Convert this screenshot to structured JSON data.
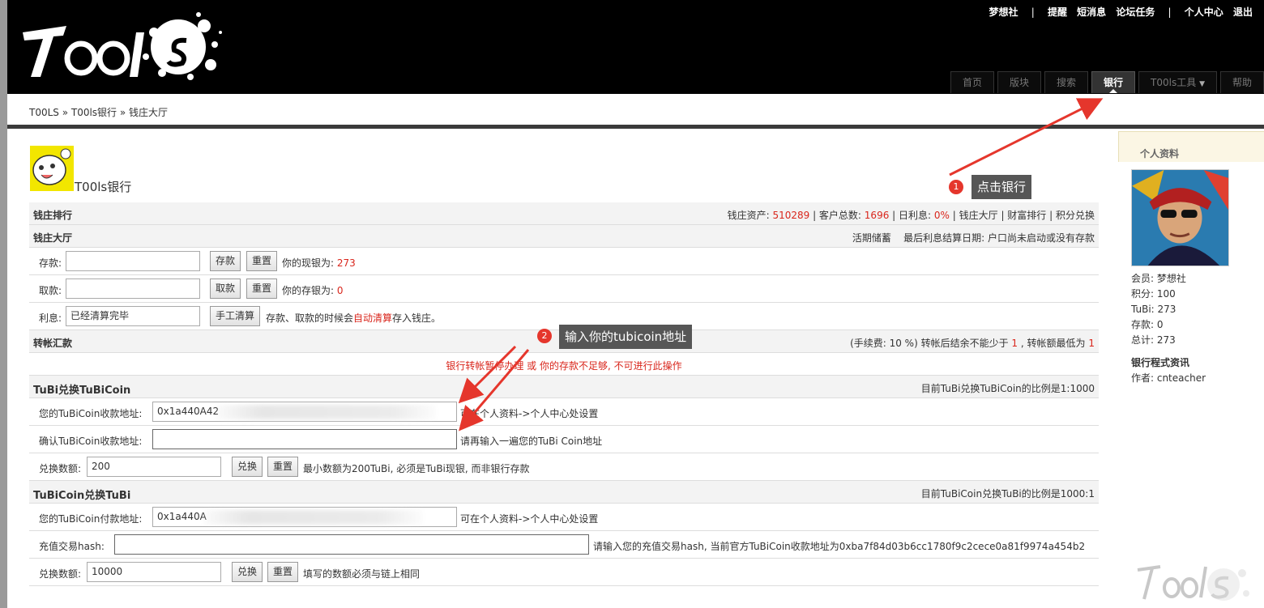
{
  "header": {
    "logo_text": "T00ls",
    "top_links": [
      "梦想社",
      "|",
      "提醒",
      "短消息",
      "论坛任务",
      "|",
      "个人中心",
      "退出"
    ],
    "nav": [
      {
        "label": "首页",
        "active": false
      },
      {
        "label": "版块",
        "active": false
      },
      {
        "label": "搜索",
        "active": false
      },
      {
        "label": "银行",
        "active": true
      },
      {
        "label": "T00ls工具",
        "active": false
      },
      {
        "label": "帮助",
        "active": false
      }
    ]
  },
  "breadcrumb": "T00LS » T00ls银行 » 钱庄大厅",
  "bank_title": "T00ls银行",
  "ranking": {
    "title": "钱庄排行",
    "assets_label": "钱庄资产:",
    "assets": "510289",
    "customers_label": "客户总数:",
    "customers": "1696",
    "interest_label": "日利息:",
    "interest": "0%",
    "links": [
      "钱庄大厅",
      "财富排行",
      "积分兑换"
    ]
  },
  "hall": {
    "title": "钱庄大厅",
    "right1": "活期储蓄",
    "right2": "最后利息结算日期: 户口尚未启动或没有存款",
    "deposit_label": "存款:",
    "deposit_btn": "存款",
    "reset": "重置",
    "cash_text": "你的现银为:",
    "cash": "273",
    "withdraw_label": "取款:",
    "withdraw_btn": "取款",
    "saving_text": "你的存银为:",
    "saving": "0",
    "interest_label": "利息:",
    "interest_value": "已经清算完毕",
    "manual_btn": "手工清算",
    "interest_note_a": "存款、取款的时候会",
    "interest_note_b": "自动清算",
    "interest_note_c": "存入钱庄。"
  },
  "transfer": {
    "title": "转帐汇款",
    "fee_a": "(手续费: 10 %) 转帐后结余不能少于",
    "fee_min": "1",
    "fee_b": ", 转帐额最低为",
    "fee_low": "1",
    "notice": "银行转帐暂停办理 或 你的存款不足够, 不可进行此操作"
  },
  "tubi_to_coin": {
    "title": "TuBi兑换TuBiCoin",
    "ratio": "目前TuBi兑换TuBiCoin的比例是1:1000",
    "addr_label": "您的TuBiCoin收款地址:",
    "addr_value": "0x1a440A42",
    "addr_note": "可在个人资料->个人中心处设置",
    "confirm_label": "确认TuBiCoin收款地址:",
    "confirm_note": "请再输入一遍您的TuBi Coin地址",
    "amount_label": "兑换数额:",
    "amount_value": "200",
    "exchange_btn": "兑换",
    "reset": "重置",
    "amount_note": "最小数额为200TuBi, 必须是TuBi现银, 而非银行存款"
  },
  "coin_to_tubi": {
    "title": "TuBiCoin兑换TuBi",
    "ratio": "目前TuBiCoin兑换TuBi的比例是1000:1",
    "addr_label": "您的TuBiCoin付款地址:",
    "addr_value": "0x1a440A",
    "addr_note": "可在个人资料->个人中心处设置",
    "hash_label": "充值交易hash:",
    "hash_note": "请输入您的充值交易hash, 当前官方TuBiCoin收款地址为0xba7f84d03b6cc1780f9c2cece0a81f9974a454b2",
    "amount_label": "兑换数额:",
    "amount_value": "10000",
    "exchange_btn": "兑换",
    "reset": "重置",
    "amount_note": "填写的数额必须与链上相同"
  },
  "profile": {
    "title": "个人资料",
    "lines": [
      "会员: 梦想社",
      "积分: 100",
      "TuBi: 273",
      "存款: 0",
      "总计: 273"
    ],
    "info_title": "银行程式资讯",
    "author": "作者: cnteacher"
  },
  "annotations": {
    "a1_num": "1",
    "a1_text": "点击银行",
    "a2_num": "2",
    "a2_text": "输入你的tubicoin地址"
  },
  "colors": {
    "accent_red": "#d9261c",
    "header_bg": "#000000",
    "arrow": "#e5362c"
  }
}
